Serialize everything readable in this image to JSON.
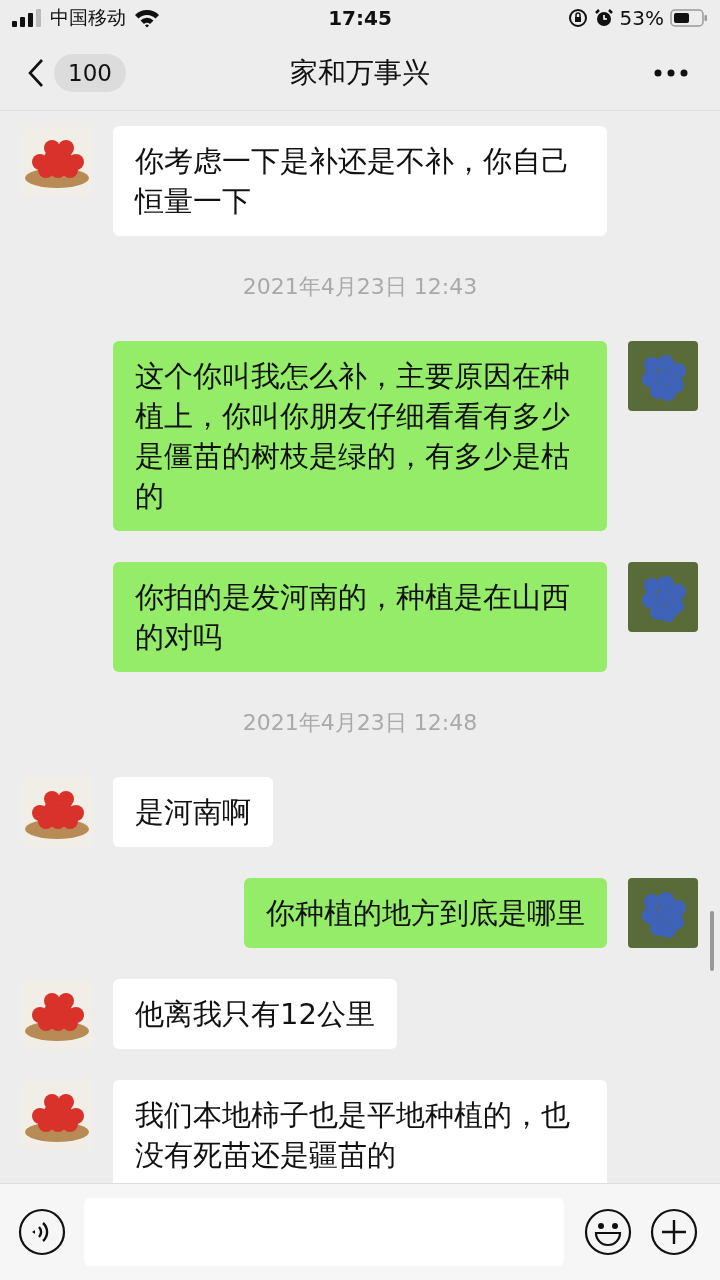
{
  "status_bar": {
    "carrier": "中国移动",
    "time": "17:45",
    "battery": "53%"
  },
  "nav": {
    "unread_count": "100",
    "title": "家和万事兴"
  },
  "messages": [
    {
      "kind": "received",
      "text": "你考虑一下是补还是不补，你自己恒量一下"
    },
    {
      "kind": "timestamp",
      "text": "2021年4月23日 12:43"
    },
    {
      "kind": "sent",
      "text": "这个你叫我怎么补，主要原因在种植上，你叫你朋友仔细看看有多少是僵苗的树枝是绿的，有多少是枯的"
    },
    {
      "kind": "sent",
      "text": "你拍的是发河南的，种植是在山西的对吗"
    },
    {
      "kind": "timestamp",
      "text": "2021年4月23日 12:48"
    },
    {
      "kind": "received",
      "text": "是河南啊"
    },
    {
      "kind": "sent",
      "text": "你种植的地方到底是哪里"
    },
    {
      "kind": "received",
      "text": "他离我只有12公里"
    },
    {
      "kind": "received",
      "text": "我们本地柿子也是平地种植的，也没有死苗还是疆苗的"
    }
  ]
}
